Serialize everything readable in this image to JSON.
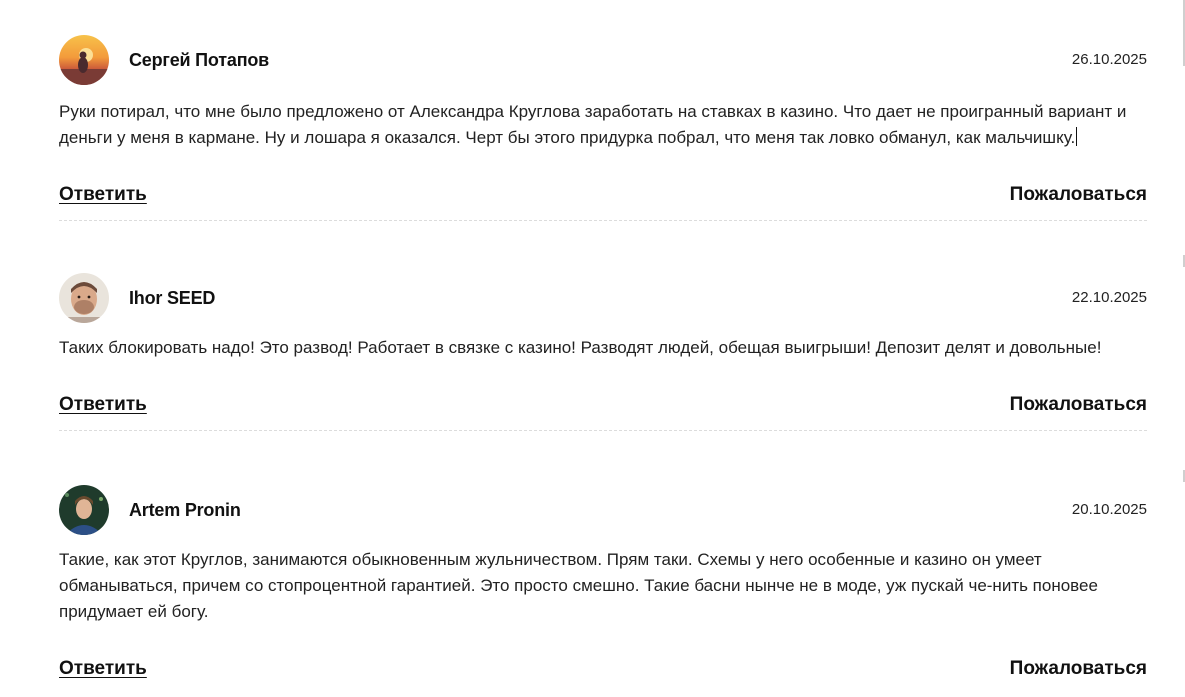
{
  "comments": [
    {
      "author": "Сергей Потапов",
      "date": "26.10.2025",
      "text": "Руки потирал, что мне было предложено от Александра Круглова заработать на ставках в казино. Что дает не проигранный вариант и деньги у меня в кармане. Ну и лошара я оказался. Черт бы этого придурка побрал, что меня так ловко обманул, как мальчишку.",
      "reply_label": "Ответить",
      "report_label": "Пожаловаться"
    },
    {
      "author": "Ihor SEED",
      "date": "22.10.2025",
      "text": "Таких блокировать надо! Это развод! Работает в связке с казино! Разводят людей, обещая выигрыши! Депозит делят и довольные!",
      "reply_label": "Ответить",
      "report_label": "Пожаловаться"
    },
    {
      "author": "Artem Pronin",
      "date": "20.10.2025",
      "text": "Такие, как этот Круглов, занимаются обыкновенным жульничеством. Прям таки. Схемы у него особенные и казино он умеет обманываться, причем со стопроцентной гарантией. Это просто смешно. Такие басни нынче не в моде, уж пускай че-нить поновее придумает ей богу.",
      "reply_label": "Ответить",
      "report_label": "Пожаловаться"
    }
  ]
}
